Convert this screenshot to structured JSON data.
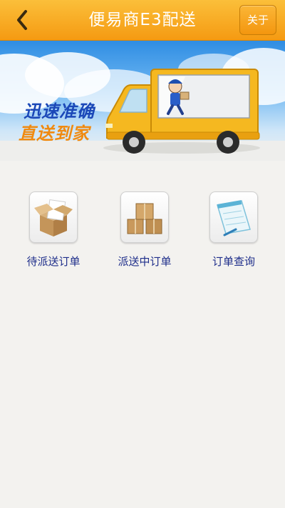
{
  "header": {
    "title": "便易商E3配送",
    "about_label": "关于",
    "back_icon": "chevron-left-icon"
  },
  "banner": {
    "slogan_line1": "迅速准确",
    "slogan_line2": "直送到家"
  },
  "menu": {
    "items": [
      {
        "label": "待派送订单",
        "icon": "open-box-icon"
      },
      {
        "label": "派送中订单",
        "icon": "stacked-boxes-icon"
      },
      {
        "label": "订单查询",
        "icon": "notepad-icon"
      }
    ]
  },
  "colors": {
    "header_orange": "#f7a521",
    "label_blue": "#1d2d8a",
    "background": "#f3f2ef"
  }
}
